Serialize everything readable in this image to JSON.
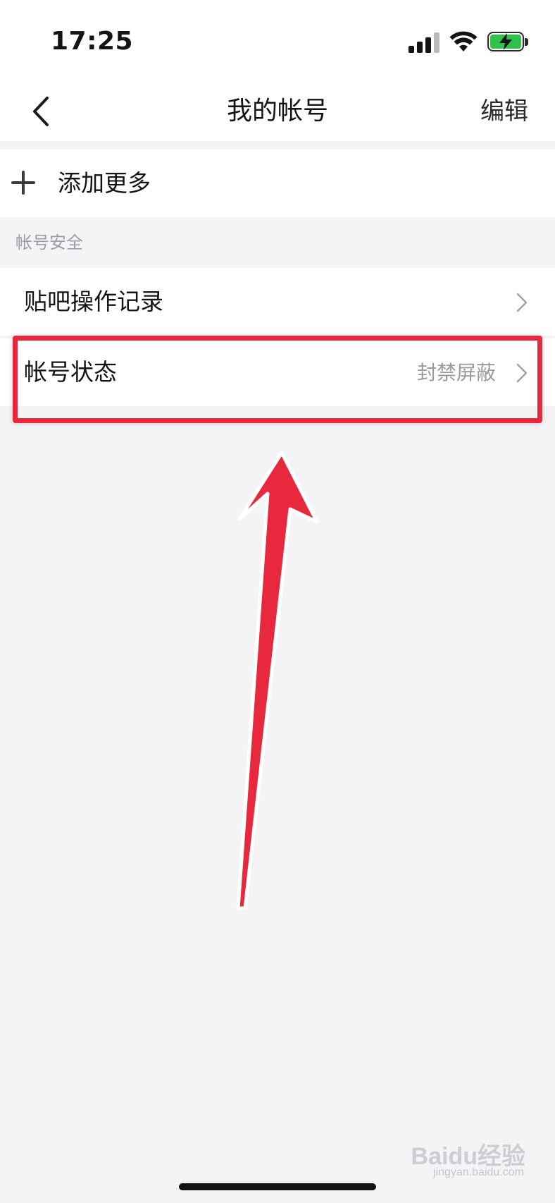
{
  "status_bar": {
    "time": "17:25",
    "icons": [
      "cellular-signal-icon",
      "wifi-icon",
      "battery-charging-icon"
    ]
  },
  "nav": {
    "title": "我的帐号",
    "edit_label": "编辑",
    "back_icon": "chevron-left-icon"
  },
  "add_more": {
    "label": "添加更多",
    "icon": "plus-icon"
  },
  "section": {
    "title": "帐号安全"
  },
  "rows": [
    {
      "label": "贴吧操作记录",
      "value": "",
      "icon": "chevron-right-icon"
    },
    {
      "label": "帐号状态",
      "value": "封禁屏蔽",
      "icon": "chevron-right-icon"
    }
  ],
  "annotation": {
    "highlight_color": "#e8283c"
  },
  "watermark": {
    "text": "Baidu经验",
    "sub": "jingyan.baidu.com"
  }
}
